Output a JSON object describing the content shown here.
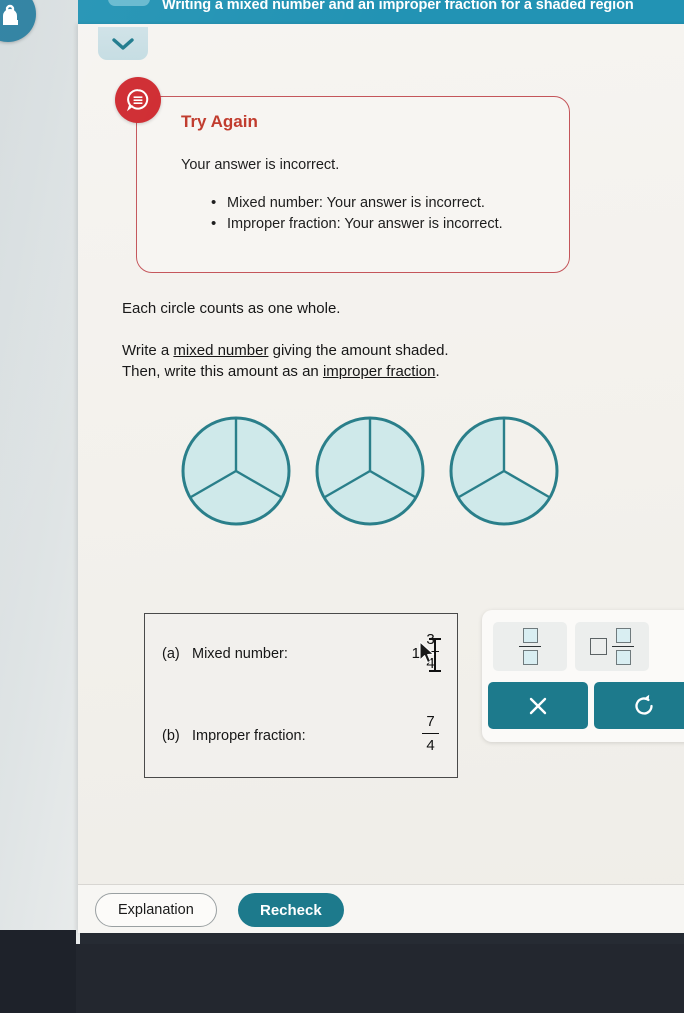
{
  "header": {
    "title": "Writing a mixed number and an improper fraction for a shaded region",
    "avatar_icon": "user-avatar-icon",
    "collapse_icon": "chevron-down-icon"
  },
  "alert": {
    "icon": "speech-bubble-icon",
    "title": "Try Again",
    "body": "Your answer is incorrect.",
    "items": [
      "Mixed number: Your answer is incorrect.",
      "Improper fraction: Your answer is incorrect."
    ],
    "accent_color": "#c0392b"
  },
  "prompt": {
    "line1": "Each circle counts as one whole.",
    "line2_a": "Write a ",
    "line2_link": "mixed number",
    "line2_b": " giving the amount shaded.",
    "line3_a": "Then, write this amount as an ",
    "line3_link": "improper fraction",
    "line3_b": "."
  },
  "figure": {
    "type": "shaded-circles",
    "sectors_per_circle": 3,
    "circles": [
      {
        "shaded": [
          true,
          true,
          true
        ]
      },
      {
        "shaded": [
          true,
          true,
          true
        ]
      },
      {
        "shaded": [
          true,
          false,
          true
        ]
      }
    ],
    "total_shaded": 8,
    "stroke_color": "#2a7f8a",
    "fill_color": "#cfe9ea"
  },
  "answers": {
    "rows": [
      {
        "letter": "(a)",
        "label": "Mixed number:",
        "whole": "1",
        "numerator": "3",
        "denominator": "4"
      },
      {
        "letter": "(b)",
        "label": "Improper fraction:",
        "whole": "",
        "numerator": "7",
        "denominator": "4"
      }
    ]
  },
  "keypad": {
    "buttons": [
      {
        "name": "fraction-template",
        "icon": "fraction-template-icon"
      },
      {
        "name": "mixed-number-template",
        "icon": "mixed-number-template-icon"
      },
      {
        "name": "clear",
        "icon": "x-icon",
        "label": "×"
      },
      {
        "name": "undo",
        "icon": "undo-icon",
        "label": "↺"
      }
    ],
    "accent_color": "#1d7a8c"
  },
  "footer": {
    "explanation_label": "Explanation",
    "recheck_label": "Recheck"
  },
  "cursor": {
    "pointer_icon": "mouse-pointer-icon",
    "caret_icon": "text-caret-icon"
  }
}
